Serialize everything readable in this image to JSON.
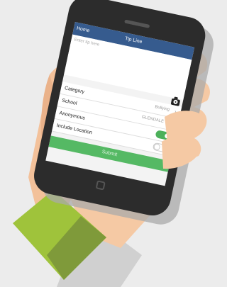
{
  "navbar": {
    "back_label": "Home",
    "title": "Tip Line"
  },
  "form": {
    "textarea_placeholder": "Enter tip here",
    "rows": [
      {
        "label": "Category",
        "value": "Bullying"
      },
      {
        "label": "School",
        "value": "GLENDALE USD"
      },
      {
        "label": "Anonymous",
        "toggle": "on"
      },
      {
        "label": "Include Location",
        "toggle": "off"
      }
    ],
    "submit_label": "Submit"
  },
  "colors": {
    "navbar": "#365b8e",
    "submit": "#55b964",
    "sleeve_light": "#9fc33b",
    "sleeve_dark": "#7f9a3a",
    "skin": "#f5c9a4",
    "phone_body": "#2c2c2c"
  },
  "icons": {
    "camera": "camera-icon",
    "chevron": "chevron-right-icon"
  }
}
